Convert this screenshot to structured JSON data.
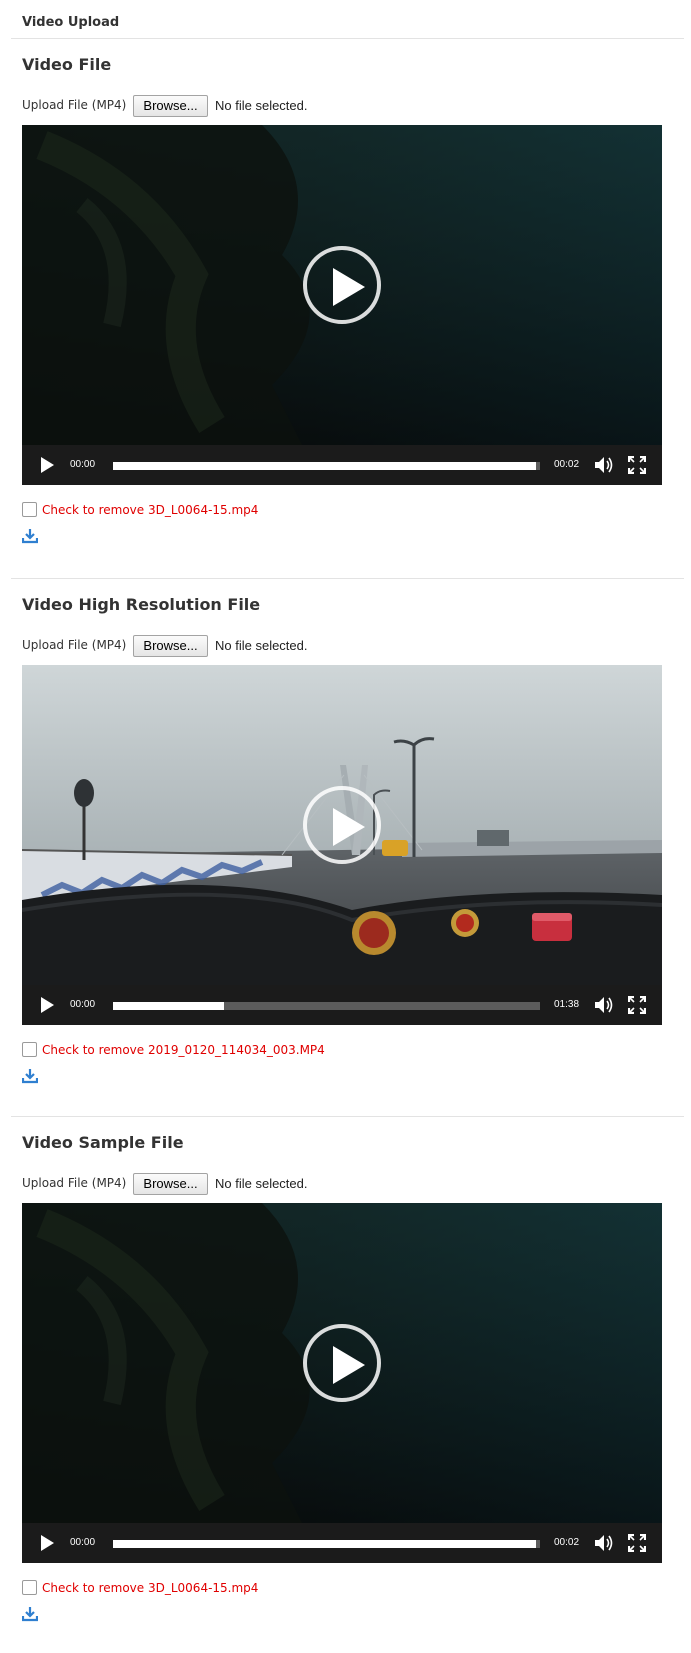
{
  "page_title": "Video Upload",
  "sections": [
    {
      "heading": "Video File",
      "upload_label": "Upload File (MP4)",
      "browse_label": "Browse...",
      "file_status": "No file selected.",
      "video": {
        "current_time": "00:00",
        "duration": "00:02",
        "progress_fraction": 0.99,
        "frame": "underwater-dark"
      },
      "remove_text": "Check to remove 3D_L0064-15.mp4",
      "remove_checked": false
    },
    {
      "heading": "Video High Resolution File",
      "upload_label": "Upload File (MP4)",
      "browse_label": "Browse...",
      "file_status": "No file selected.",
      "video": {
        "current_time": "00:00",
        "duration": "01:38",
        "progress_fraction": 0.26,
        "frame": "bridge-road"
      },
      "remove_text": "Check to remove 2019_0120_114034_003.MP4",
      "remove_checked": false
    },
    {
      "heading": "Video Sample File",
      "upload_label": "Upload File (MP4)",
      "browse_label": "Browse...",
      "file_status": "No file selected.",
      "video": {
        "current_time": "00:00",
        "duration": "00:02",
        "progress_fraction": 0.99,
        "frame": "underwater-dark"
      },
      "remove_text": "Check to remove 3D_L0064-15.mp4",
      "remove_checked": false
    }
  ],
  "icons": {
    "play": "play-icon",
    "volume": "volume-icon",
    "fullscreen": "fullscreen-icon",
    "download": "download-icon"
  },
  "colors": {
    "remove_text": "#e00000",
    "download_icon": "#2f7fd0",
    "controls_bar": "#1b1b1b"
  }
}
